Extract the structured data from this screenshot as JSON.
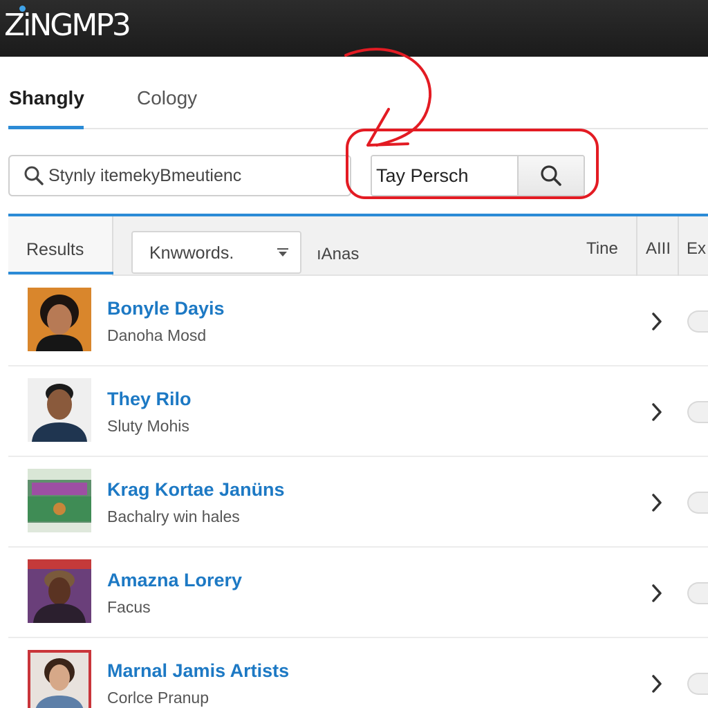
{
  "app": {
    "logo": "ZiNGMP3"
  },
  "nav": {
    "tabs": [
      {
        "label": "Shangly",
        "active": true
      },
      {
        "label": "Cology",
        "active": false
      }
    ]
  },
  "search": {
    "main_value": "Stynly itemekyBmeutienc",
    "secondary_value": "Tay Persch"
  },
  "results": {
    "tab_label": "Results",
    "keyword_select": "Knwwords.",
    "filter_label": "ıAnas",
    "columns": {
      "time": "Tine",
      "all": "AIII",
      "extra": "Ex"
    },
    "items": [
      {
        "title": "Bonyle Dayis",
        "subtitle": "Danoha Mosd",
        "thumb": "portrait-curly-hair"
      },
      {
        "title": "They Rilo",
        "subtitle": "Sluty Mohis",
        "thumb": "portrait-man"
      },
      {
        "title": "Krag Kortae Janüns",
        "subtitle": "Bachalry win hales",
        "thumb": "album-cover-landscape"
      },
      {
        "title": "Amazna Lorery",
        "subtitle": "Facus",
        "thumb": "album-cover-woman-hat"
      },
      {
        "title": "Marnal Jamis Artists",
        "subtitle": "Corlce Pranup",
        "thumb": "magazine-cover-woman"
      }
    ]
  },
  "colors": {
    "accent": "#2b8bd6",
    "link": "#1d79c4",
    "annotation": "#e31b23",
    "topbar": "#222222"
  }
}
